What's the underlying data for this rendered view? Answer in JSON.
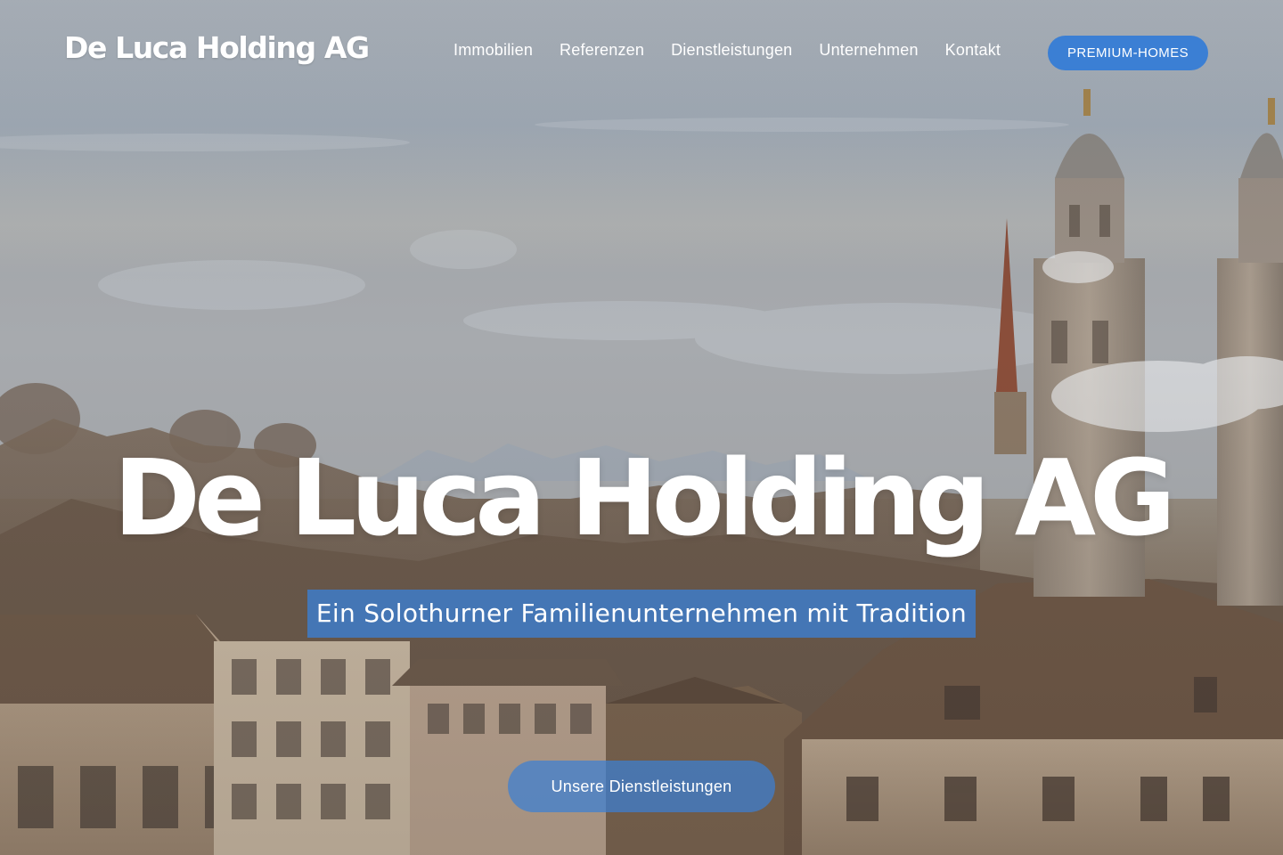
{
  "header": {
    "logo_text": "De Luca Holding AG",
    "nav": [
      {
        "label": "Immobilien"
      },
      {
        "label": "Referenzen"
      },
      {
        "label": "Dienstleistungen"
      },
      {
        "label": "Unternehmen"
      },
      {
        "label": "Kontakt"
      }
    ],
    "cta_label": "PREMIUM-HOMES"
  },
  "hero": {
    "title": "De Luca Holding AG",
    "subtitle": "Ein Solothurner Familienunternehmen mit Tradition",
    "cta_label": "Unsere Dienstleistungen"
  },
  "colors": {
    "accent": "#3b7fd4",
    "text": "#ffffff"
  }
}
